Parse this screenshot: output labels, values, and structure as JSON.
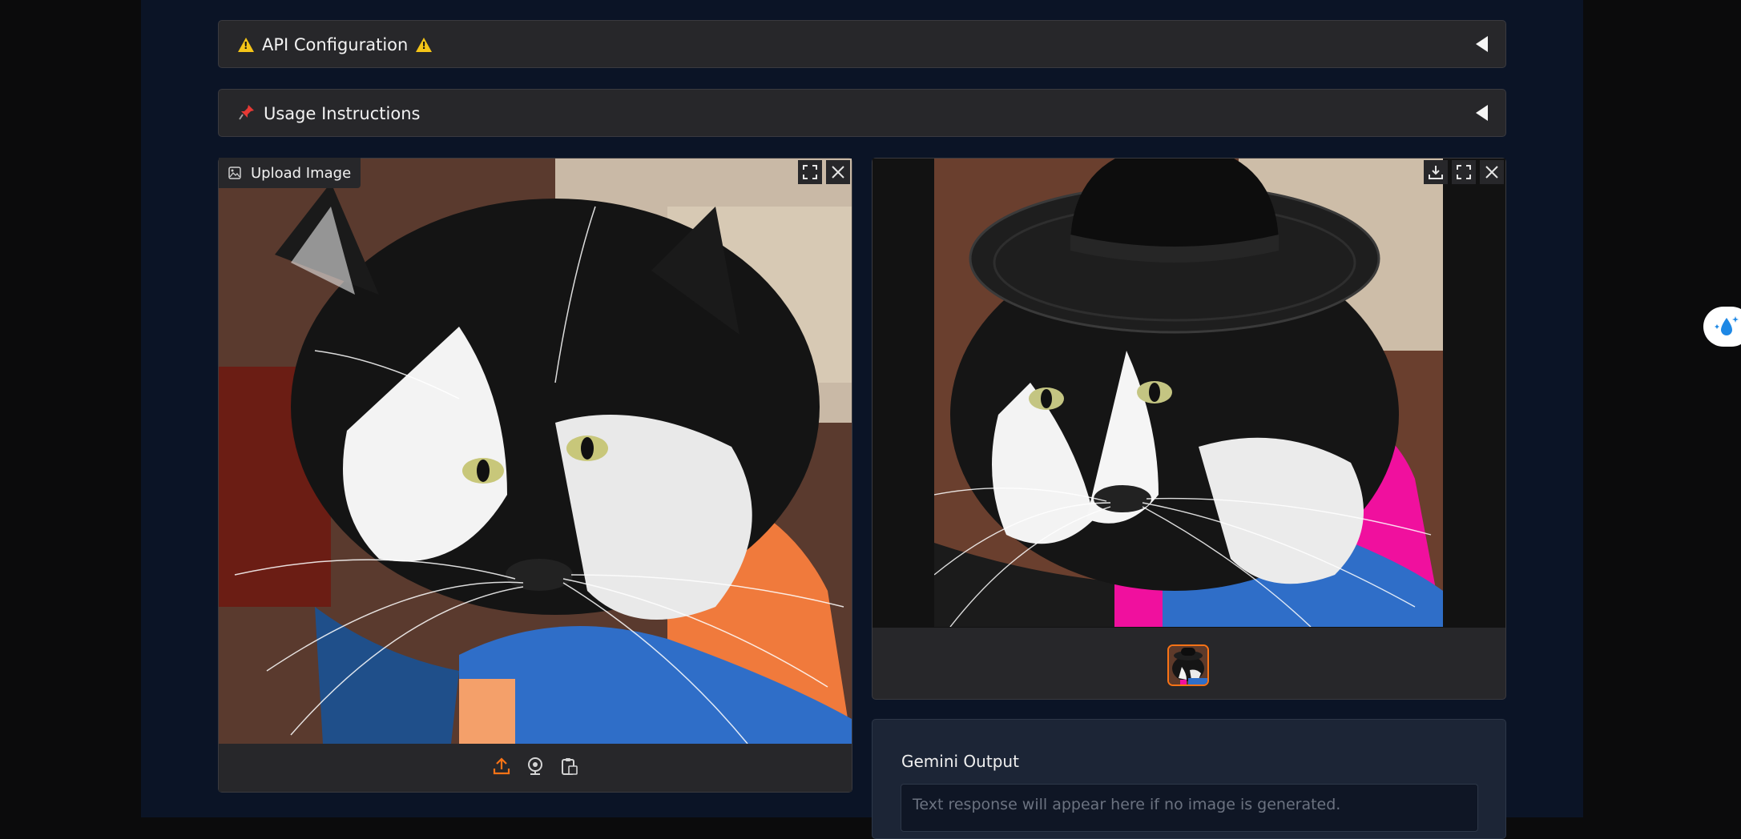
{
  "accordions": [
    {
      "label": "API Configuration",
      "icon": "warning-icon"
    },
    {
      "label": "Usage Instructions",
      "icon": "pushpin-icon"
    }
  ],
  "input_panel": {
    "upload_label": "Upload Image",
    "icons": [
      "fullscreen-icon",
      "close-icon",
      "upload-icon",
      "webcam-icon",
      "clipboard-icon"
    ]
  },
  "output_panel": {
    "icons": [
      "download-icon",
      "fullscreen-icon",
      "close-icon"
    ]
  },
  "gemini": {
    "title": "Gemini Output",
    "placeholder": "Text response will appear here if no image is generated."
  },
  "colors": {
    "accent": "#f97316",
    "page_bg": "#0b1426",
    "panel_bg": "#27272a"
  }
}
